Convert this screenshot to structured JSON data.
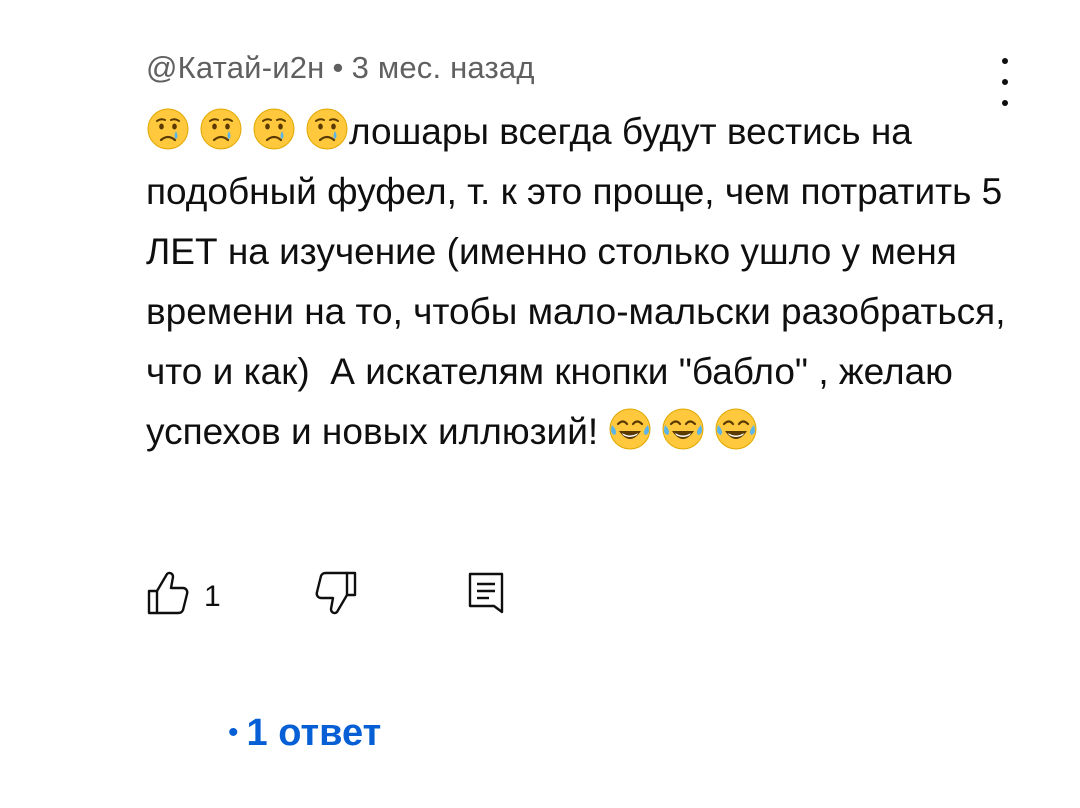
{
  "comment": {
    "author": "@Катай-и2н",
    "separator": "•",
    "time": "3 мес. назад",
    "text_main": "лошары всегда будут вестись на подобный фуфел, т. к это проще, чем потратить 5 ЛЕТ на изучение (именно столько ушло у меня времени на то, чтобы мало-мальски разобраться, что и как)  А искателям кнопки \"бабло\" , желаю успехов и новых иллюзий! ",
    "leading_emoji": [
      "crying-face",
      "crying-face",
      "crying-face",
      "crying-face"
    ],
    "trailing_emoji": [
      "tears-of-joy",
      "tears-of-joy",
      "tears-of-joy"
    ],
    "like_count": "1"
  },
  "replies": {
    "bullet": "•",
    "label": "1 ответ"
  },
  "colors": {
    "meta": "#606060",
    "text": "#0f0f0f",
    "link": "#065fd4",
    "emoji_yellow": "#ffc83d",
    "tear_blue": "#5bb5e8"
  },
  "icons": [
    "more-vert-icon",
    "thumb-up-icon",
    "thumb-down-icon",
    "reply-icon"
  ]
}
